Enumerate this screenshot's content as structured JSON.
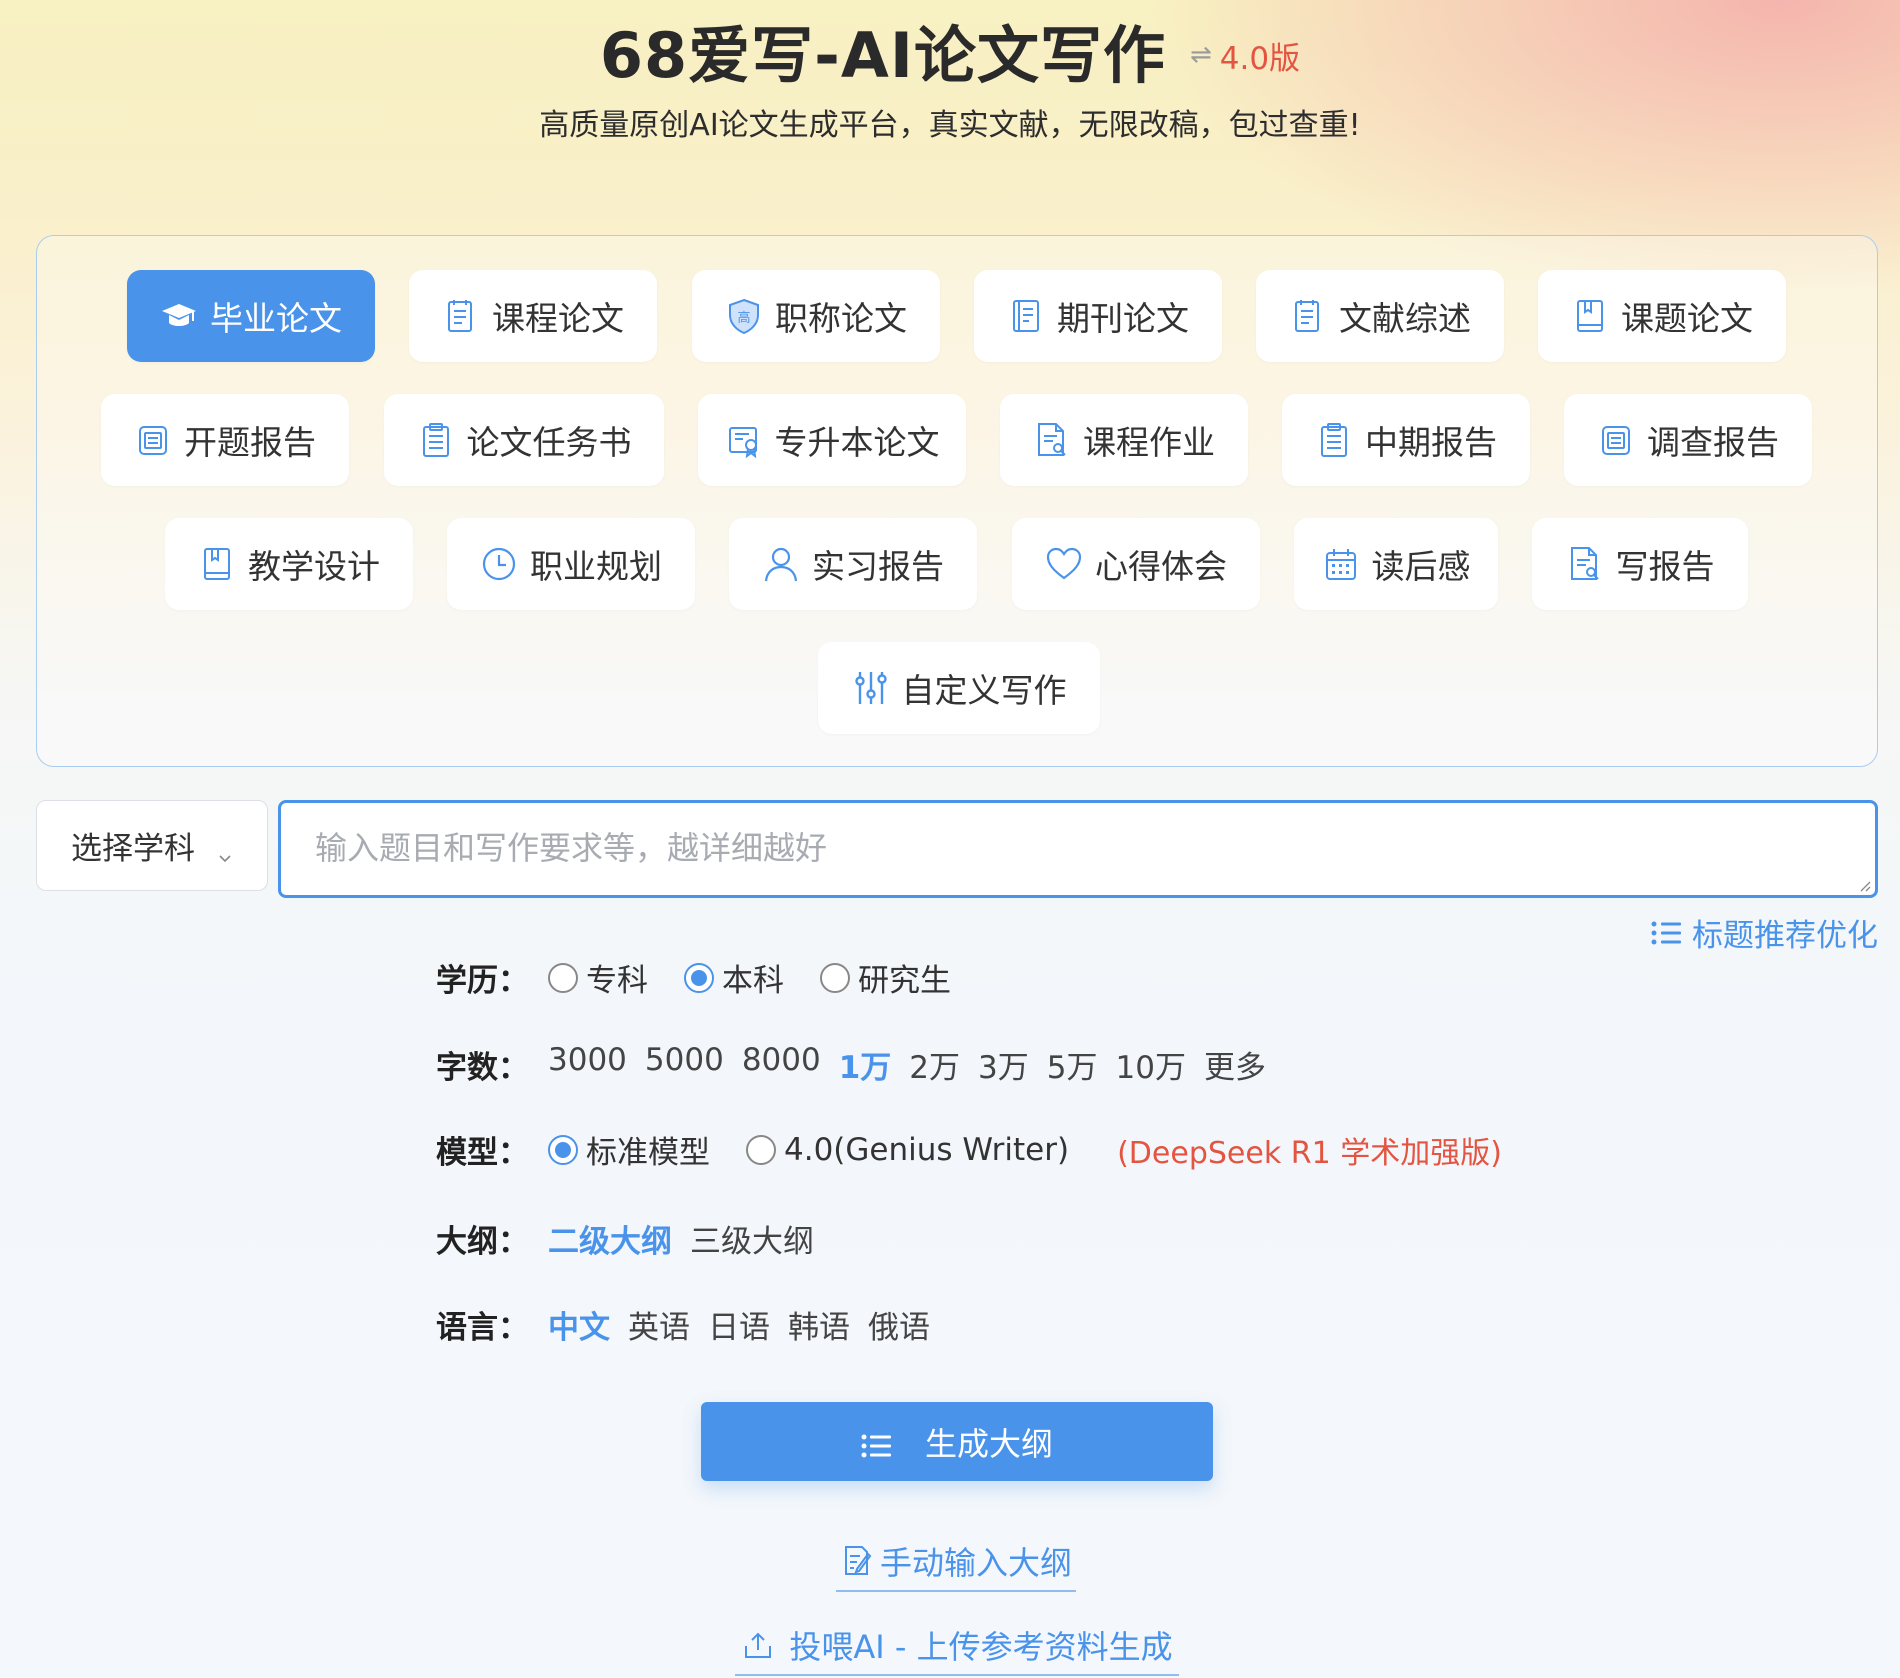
{
  "header": {
    "title": "68爱写-AI论文写作",
    "version_label": "4.0版",
    "subtitle": "高质量原创AI论文生成平台，真实文献，无限改稿，包过查重!"
  },
  "categories": [
    {
      "label": "毕业论文",
      "icon": "graduation-cap-icon"
    },
    {
      "label": "课程论文",
      "icon": "document-icon"
    },
    {
      "label": "职称论文",
      "icon": "shield-badge-icon"
    },
    {
      "label": "期刊论文",
      "icon": "journal-icon"
    },
    {
      "label": "文献综述",
      "icon": "document-icon"
    },
    {
      "label": "课题论文",
      "icon": "book-icon"
    },
    {
      "label": "开题报告",
      "icon": "report-icon"
    },
    {
      "label": "论文任务书",
      "icon": "clipboard-icon"
    },
    {
      "label": "专升本论文",
      "icon": "certificate-icon"
    },
    {
      "label": "课程作业",
      "icon": "file-search-icon"
    },
    {
      "label": "中期报告",
      "icon": "clipboard-icon"
    },
    {
      "label": "调查报告",
      "icon": "report-icon"
    },
    {
      "label": "教学设计",
      "icon": "book-icon"
    },
    {
      "label": "职业规划",
      "icon": "clock-icon"
    },
    {
      "label": "实习报告",
      "icon": "user-icon"
    },
    {
      "label": "心得体会",
      "icon": "heart-icon"
    },
    {
      "label": "读后感",
      "icon": "calendar-icon"
    },
    {
      "label": "写报告",
      "icon": "file-search-icon"
    },
    {
      "label": "自定义写作",
      "icon": "sliders-icon"
    }
  ],
  "subject_select": {
    "label": "选择学科"
  },
  "topic_input": {
    "placeholder": "输入题目和写作要求等，越详细越好",
    "value": ""
  },
  "recommend_link": "标题推荐优化",
  "education": {
    "label": "学历：",
    "options": [
      "专科",
      "本科",
      "研究生"
    ],
    "selected": "本科"
  },
  "word_count": {
    "label": "字数：",
    "options": [
      "3000",
      "5000",
      "8000",
      "1万",
      "2万",
      "3万",
      "5万",
      "10万",
      "更多"
    ],
    "selected": "1万"
  },
  "model": {
    "label": "模型：",
    "options": [
      "标准模型",
      "4.0(Genius Writer)"
    ],
    "selected": "标准模型",
    "note": "(DeepSeek R1 学术加强版)"
  },
  "outline": {
    "label": "大纲：",
    "options": [
      "二级大纲",
      "三级大纲"
    ],
    "selected": "二级大纲"
  },
  "language": {
    "label": "语言：",
    "options": [
      "中文",
      "英语",
      "日语",
      "韩语",
      "俄语"
    ],
    "selected": "中文"
  },
  "generate_button": "生成大纲",
  "manual_outline_link": "手动输入大纲",
  "upload_link": "投喂AI - 上传参考资料生成",
  "colors": {
    "accent": "#4a93ea",
    "highlight": "#e35441"
  }
}
